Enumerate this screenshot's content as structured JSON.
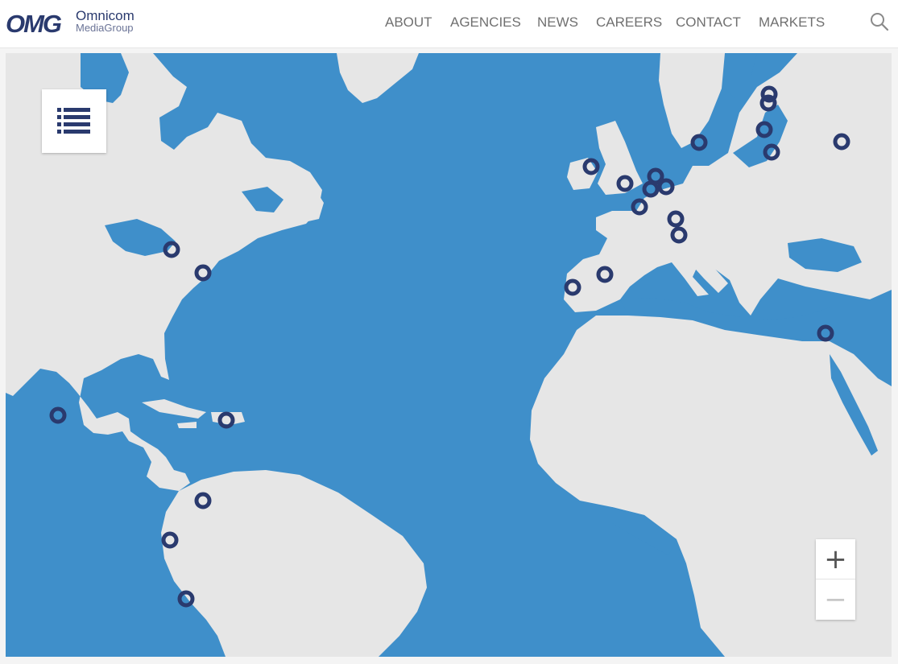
{
  "header": {
    "logo": {
      "mark": "OMG",
      "line1": "Omnicom",
      "line2": "MediaGroup"
    },
    "nav": [
      {
        "label": "ABOUT"
      },
      {
        "label": "AGENCIES"
      },
      {
        "label": "NEWS"
      },
      {
        "label": "CAREERS"
      },
      {
        "label": "CONTACT"
      },
      {
        "label": "MARKETS"
      }
    ],
    "search_icon": "search-icon"
  },
  "map": {
    "colors": {
      "water": "#3f8fca",
      "land": "#e6e6e6",
      "border": "#b8b8b8",
      "marker": "#2a3a6e"
    },
    "controls": {
      "list_icon": "list-icon",
      "zoom_in": "+",
      "zoom_out": "−"
    }
  }
}
